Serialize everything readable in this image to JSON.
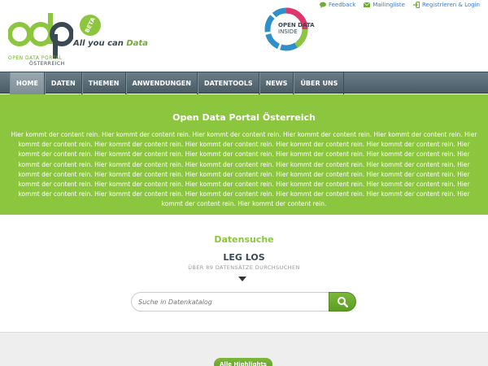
{
  "header": {
    "logo_beta": "BETA",
    "tagline_prefix": "All you can ",
    "tagline_highlight": "Data",
    "portal_name": "OPEN DATA PORTAL",
    "portal_country": "ÖSTERREICH",
    "badge_line1": "OPEN DATA",
    "badge_line2": "INSIDE",
    "links": {
      "feedback": "Feedback",
      "mailing": "Mailingliste",
      "register": "Registrieren & Login"
    }
  },
  "nav": {
    "items": [
      "HOME",
      "DATEN",
      "THEMEN",
      "ANWENDUNGEN",
      "DATENTOOLS",
      "NEWS",
      "ÜBER UNS"
    ],
    "active": "HOME"
  },
  "hero": {
    "title": "Open Data Portal Österreich",
    "text": "Hier kommt der content rein. Hier kommt der content rein. Hier kommt der content rein. Hier kommt der content rein. Hier kommt der content rein. Hier kommt der content rein. Hier kommt der content rein. Hier kommt der content rein. Hier kommt der content rein. Hier kommt der content rein. Hier kommt der content rein. Hier kommt der content rein. Hier kommt der content rein. Hier kommt der content rein. Hier kommt der content rein. Hier kommt der content rein. Hier kommt der content rein. Hier kommt der content rein. Hier kommt der content rein. Hier kommt der content rein. Hier kommt der content rein. Hier kommt der content rein. Hier kommt der content rein. Hier kommt der content rein. Hier kommt der content rein. Hier kommt der content rein. Hier kommt der content rein. Hier kommt der content rein. Hier kommt der content rein. Hier kommt der content rein. Hier kommt der content rein. Hier kommt der content rein. Hier kommt der content rein. Hier kommt der content rein. Hier kommt der content rein. Hier kommt der content rein. Hier kommt der content rein."
  },
  "search": {
    "title": "Datensuche",
    "subtitle": "LEG LOS",
    "count": "ÜBER 89 DATENSÄTZE DURCHSUCHEN",
    "placeholder": "Suche in Datenkatalog"
  },
  "highlights": {
    "button": "Alle Highlights"
  },
  "colors": {
    "brand_green": "#8cc63f",
    "nav_dark": "#4a5c66",
    "link_blue": "#3a7dc9"
  }
}
